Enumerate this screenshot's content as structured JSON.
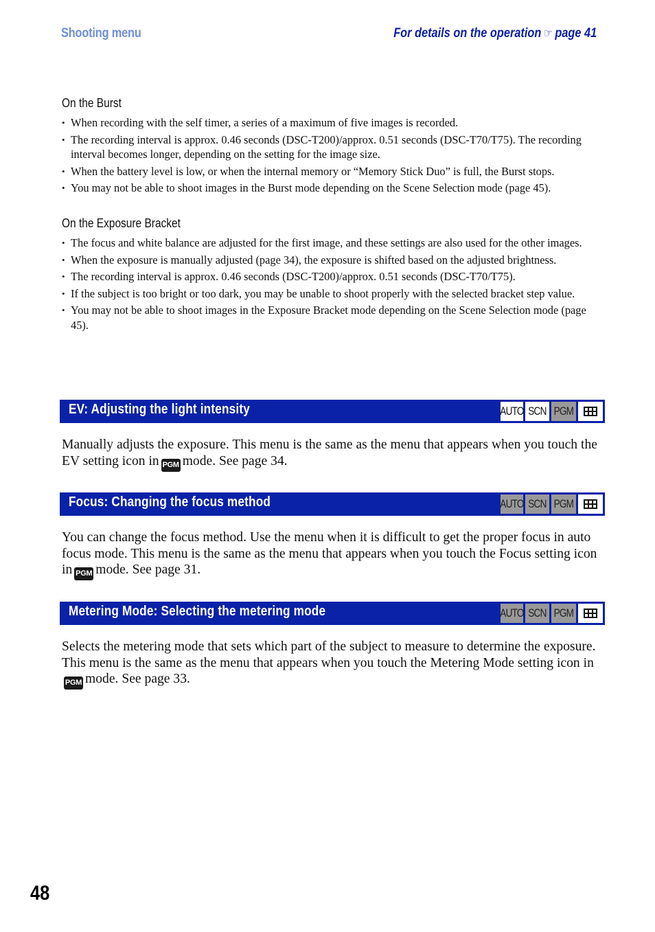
{
  "header": {
    "section": "Shooting menu",
    "details_prefix": "For details on the operation",
    "details_icon": "pointing-hand",
    "details_page": "page 41"
  },
  "burst": {
    "heading": "On the Burst",
    "items": [
      "When recording with the self timer, a series of a maximum of five images is recorded.",
      "The recording interval is approx. 0.46 seconds (DSC-T200)/approx. 0.51 seconds (DSC-T70/T75). The recording interval becomes longer, depending on the setting for the image size.",
      "When the battery level is low, or when the internal memory or “Memory Stick Duo” is full, the Burst stops.",
      "You may not be able to shoot images in the Burst mode depending on the Scene Selection mode (page 45)."
    ]
  },
  "bracket": {
    "heading": "On the Exposure Bracket",
    "items": [
      "The focus and white balance are adjusted for the first image, and these settings are also used for the other images.",
      "When the exposure is manually adjusted (page 34), the exposure is shifted based on the adjusted brightness.",
      "The recording interval is approx. 0.46 seconds (DSC-T200)/approx. 0.51 seconds (DSC-T70/T75).",
      "If the subject is too bright or too dark, you may be unable to shoot properly with the selected bracket step value.",
      "You may not be able to shoot images in the Exposure Bracket mode depending on the Scene Selection mode (page 45)."
    ]
  },
  "modes": {
    "auto": "AUTO",
    "scn": "SCN",
    "pgm": "PGM",
    "movie": "movie-icon"
  },
  "pgm_icon_label": "PGM",
  "sections": [
    {
      "title": "EV: Adjusting the light intensity",
      "available": {
        "auto": true,
        "scn": true,
        "pgm": false,
        "movie": true
      },
      "text_before": "Manually adjusts the exposure. This menu is the same as the menu that appears when you touch the EV setting icon in",
      "text_after": "mode. See page 34."
    },
    {
      "title": "Focus: Changing the focus method",
      "available": {
        "auto": false,
        "scn": false,
        "pgm": false,
        "movie": true
      },
      "text_before": "You can change the focus method. Use the menu when it is difficult to get the proper focus in auto focus mode. This menu is the same as the menu that appears when you touch the Focus setting icon in",
      "text_after": "mode. See page 31."
    },
    {
      "title": "Metering Mode: Selecting the metering mode",
      "available": {
        "auto": false,
        "scn": false,
        "pgm": false,
        "movie": true
      },
      "text_before": "Selects the metering mode that sets which part of the subject to measure to determine the exposure. This menu is the same as the menu that appears when you touch the Metering Mode setting icon in",
      "text_after": "mode. See page 33."
    }
  ],
  "page_number": "48",
  "colors": {
    "section_bar": "#0a22a8",
    "header_left": "#6f8ed6",
    "header_right": "#0d1fa3",
    "mode_off": "#999999"
  }
}
